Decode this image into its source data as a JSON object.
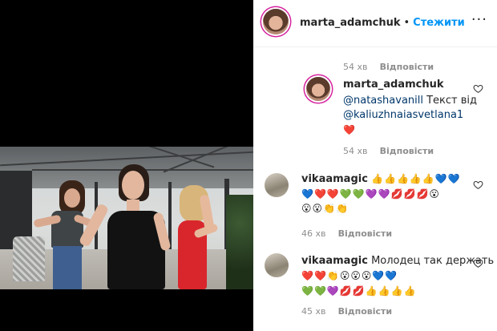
{
  "header": {
    "username": "marta_adamchuk",
    "separator": "•",
    "follow_label": "Стежити",
    "more_label": "···"
  },
  "top_reply_row": {
    "time": "54 хв",
    "reply_label": "Відповісти"
  },
  "comments": [
    {
      "username": "marta_adamchuk",
      "mention1": "@natashavanill",
      "text_mid": " Текст від",
      "mention2": "@kaliuzhnaiasvetlana1",
      "emoji_line": "❤️",
      "time": "54 хв",
      "reply_label": "Відповісти"
    },
    {
      "username": "vikaamagic",
      "emoji_line1": "👍👍👍👍👍💙💙",
      "emoji_line2": "💙❤️❤️💚💚💜💜💋💋💋😮",
      "emoji_line3": "😮😮👏👏",
      "time": "46 хв",
      "reply_label": "Відповісти"
    },
    {
      "username": "vikaamagic",
      "text": "Молодец так держать",
      "emoji_inline": "❤️❤️👏😮😮😮💙💙",
      "emoji_line2": "💚💚💜💋💋👍👍👍👍",
      "time": "45 хв",
      "reply_label": "Відповісти"
    }
  ],
  "icons": {
    "more": "more-options-icon",
    "like": "heart-outline-icon"
  },
  "colors": {
    "follow_blue": "#0095f6",
    "mention_blue": "#00376b",
    "muted_gray": "#8e8e8e",
    "story_ring": "#d6249f"
  }
}
